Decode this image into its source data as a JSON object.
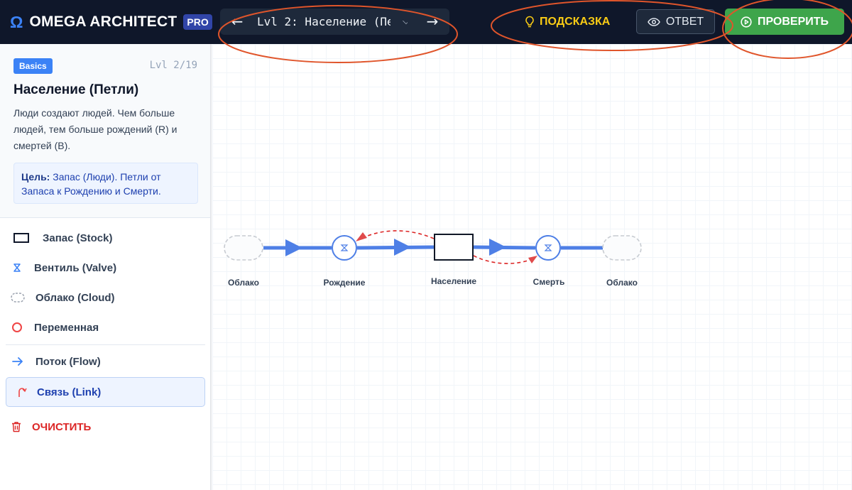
{
  "header": {
    "brand_icon": "omega-icon",
    "brand_name": "OMEGA ARCHITECT",
    "pro_badge": "PRO",
    "level_select": "Lvl 2: Население (Пе",
    "prev_arrow": "←",
    "next_arrow": "→",
    "hint_label": "ПОДСКАЗКА",
    "answer_label": "ОТВЕТ",
    "check_label": "ПРОВЕРИТЬ"
  },
  "level": {
    "badge": "Basics",
    "counter": "Lvl 2/19",
    "title": "Население (Петли)",
    "description": "Люди создают людей. Чем больше людей, тем больше рождений (R) и смертей (B).",
    "goal_label": "Цель:",
    "goal_text": " Запас (Люди). Петли от Запаса к Рождению и Смерти."
  },
  "tools": {
    "stock": "Запас (Stock)",
    "valve": "Вентиль (Valve)",
    "cloud": "Облако (Cloud)",
    "variable": "Переменная",
    "flow": "Поток (Flow)",
    "link": "Связь (Link)",
    "clear": "ОЧИСТИТЬ"
  },
  "diagram": {
    "nodes": {
      "cloud_left": "Облако",
      "valve_birth": "Рождение",
      "stock_population": "Население",
      "valve_death": "Смерть",
      "cloud_right": "Облако"
    },
    "valve_symbol": "⧖"
  },
  "colors": {
    "accent": "#3b82f6",
    "header_bg": "#0f172a",
    "hint": "#facc15",
    "check": "#3ea54b",
    "link": "#dc2626",
    "annotation": "#e0552b"
  }
}
